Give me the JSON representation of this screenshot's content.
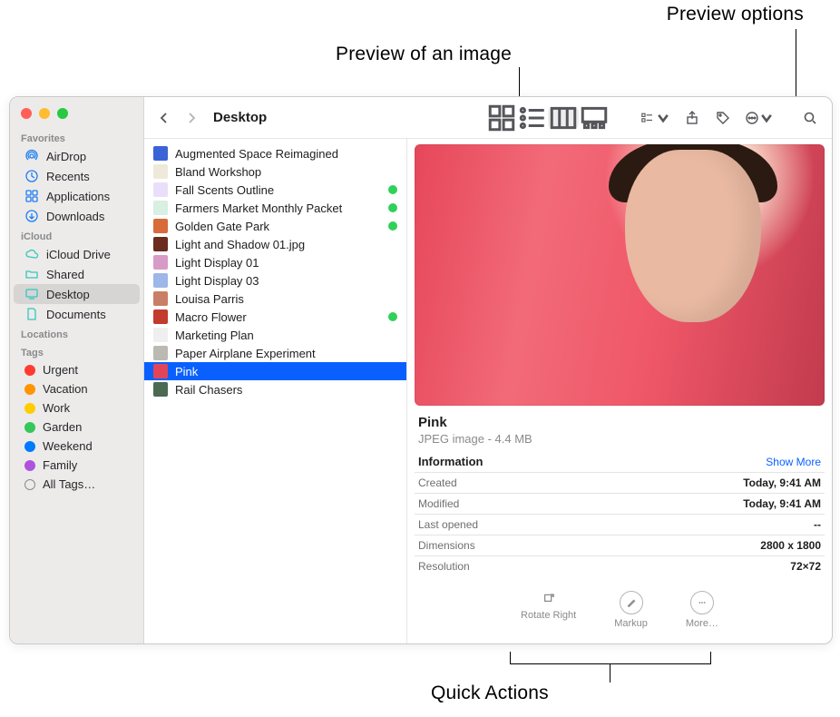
{
  "callouts": {
    "preview_options": "Preview options",
    "preview_image": "Preview of an image",
    "quick_actions": "Quick Actions"
  },
  "traffic": {
    "close": "#ff5f57",
    "minimize": "#febc2e",
    "zoom": "#28c840"
  },
  "toolbar": {
    "title": "Desktop"
  },
  "sidebar": {
    "sections": [
      {
        "title": "Favorites",
        "items": [
          {
            "label": "AirDrop",
            "icon": "airdrop",
            "selected": false
          },
          {
            "label": "Recents",
            "icon": "clock",
            "selected": false
          },
          {
            "label": "Applications",
            "icon": "apps",
            "selected": false
          },
          {
            "label": "Downloads",
            "icon": "downloads",
            "selected": false
          }
        ]
      },
      {
        "title": "iCloud",
        "items": [
          {
            "label": "iCloud Drive",
            "icon": "cloud",
            "selected": false
          },
          {
            "label": "Shared",
            "icon": "folder",
            "selected": false
          },
          {
            "label": "Desktop",
            "icon": "desktop",
            "selected": true
          },
          {
            "label": "Documents",
            "icon": "doc",
            "selected": false
          }
        ]
      },
      {
        "title": "Locations",
        "items": []
      },
      {
        "title": "Tags",
        "items": [
          {
            "label": "Urgent",
            "color": "#ff3b30"
          },
          {
            "label": "Vacation",
            "color": "#ff9500"
          },
          {
            "label": "Work",
            "color": "#ffcc00"
          },
          {
            "label": "Garden",
            "color": "#34c759"
          },
          {
            "label": "Weekend",
            "color": "#007aff"
          },
          {
            "label": "Family",
            "color": "#af52de"
          },
          {
            "label": "All Tags…",
            "color": "outline"
          }
        ]
      }
    ]
  },
  "files": [
    {
      "name": "Augmented Space Reimagined",
      "thumb": "#3a63d6",
      "tagged": false
    },
    {
      "name": "Bland Workshop",
      "thumb": "#efe9da",
      "tagged": false
    },
    {
      "name": "Fall Scents Outline",
      "thumb": "#eadffb",
      "tagged": true
    },
    {
      "name": "Farmers Market Monthly Packet",
      "thumb": "#d8efe2",
      "tagged": true
    },
    {
      "name": "Golden Gate Park",
      "thumb": "#d86b3a",
      "tagged": true
    },
    {
      "name": "Light and Shadow 01.jpg",
      "thumb": "#6b2b1f",
      "tagged": false
    },
    {
      "name": "Light Display 01",
      "thumb": "#d89bc7",
      "tagged": false
    },
    {
      "name": "Light Display 03",
      "thumb": "#9cb7e8",
      "tagged": false
    },
    {
      "name": "Louisa Parris",
      "thumb": "#c97f66",
      "tagged": false
    },
    {
      "name": "Macro Flower",
      "thumb": "#c33a2e",
      "tagged": true
    },
    {
      "name": "Marketing Plan",
      "thumb": "#efefef",
      "tagged": false
    },
    {
      "name": "Paper Airplane Experiment",
      "thumb": "#bcb9b3",
      "tagged": false
    },
    {
      "name": "Pink",
      "thumb": "#e2455a",
      "tagged": false,
      "selected": true
    },
    {
      "name": "Rail Chasers",
      "thumb": "#4a6a53",
      "tagged": false
    }
  ],
  "preview": {
    "title": "Pink",
    "subtitle": "JPEG image - 4.4 MB",
    "info_heading": "Information",
    "show_more": "Show More",
    "rows": [
      {
        "k": "Created",
        "v": "Today, 9:41 AM"
      },
      {
        "k": "Modified",
        "v": "Today, 9:41 AM"
      },
      {
        "k": "Last opened",
        "v": "--"
      },
      {
        "k": "Dimensions",
        "v": "2800 x 1800"
      },
      {
        "k": "Resolution",
        "v": "72×72"
      }
    ],
    "actions": {
      "rotate": "Rotate Right",
      "markup": "Markup",
      "more": "More…"
    }
  }
}
